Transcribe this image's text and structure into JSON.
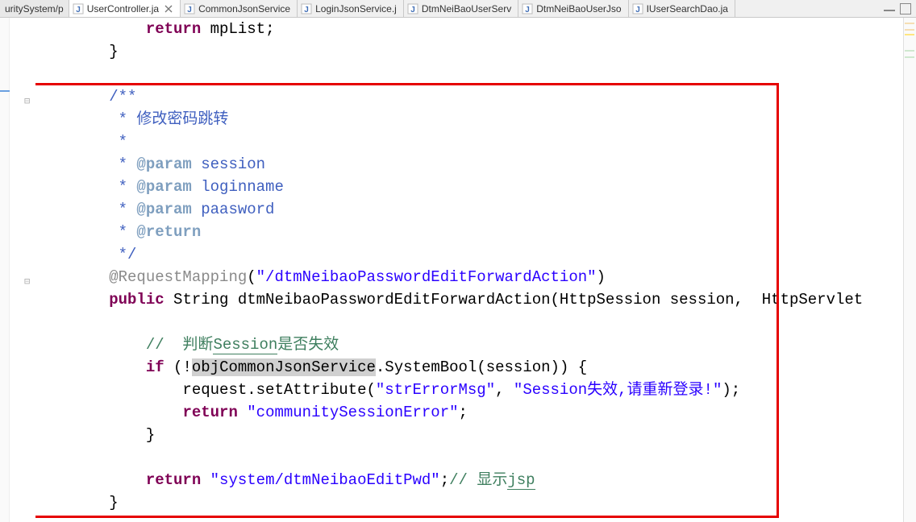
{
  "truncated_tab": "uritySystem/p",
  "tabs": [
    {
      "label": "UserController.ja",
      "active": true,
      "closable": true
    },
    {
      "label": "CommonJsonService",
      "active": false,
      "closable": false
    },
    {
      "label": "LoginJsonService.j",
      "active": false,
      "closable": false
    },
    {
      "label": "DtmNeiBaoUserServ",
      "active": false,
      "closable": false
    },
    {
      "label": "DtmNeiBaoUserJso",
      "active": false,
      "closable": false
    },
    {
      "label": "IUserSearchDao.ja",
      "active": false,
      "closable": false
    }
  ],
  "code": {
    "l1_return": "return",
    "l1_rest": " mpList;",
    "l2": "        }",
    "jdoc_open": "/**",
    "jdoc_desc": " * 修改密码跳转",
    "jdoc_blank": " *",
    "jdoc_tag_param": "@param",
    "jdoc_p1": " session",
    "jdoc_p2": " loginname",
    "jdoc_p3": " paasword",
    "jdoc_tag_return": "@return",
    "jdoc_close": " */",
    "anno_name": "@RequestMapping",
    "anno_arg": "\"/dtmNeibaoPasswordEditForwardAction\"",
    "sig_public": "public",
    "sig_rest": " String dtmNeibaoPasswordEditForwardAction(HttpSession session,  HttpServlet",
    "cmt1_a": "//  判断",
    "cmt1_b": "Session",
    "cmt1_c": "是否失效",
    "if_kw": "if",
    "if_open": " (!",
    "if_obj": "objCommonJsonService",
    "if_rest": ".SystemBool(session)) {",
    "req_a": "                request.setAttribute(",
    "req_s1": "\"strErrorMsg\"",
    "req_mid": ", ",
    "req_s2a": "\"Session",
    "req_s2b": "失效,请重新登录",
    "req_s2c": "!\"",
    "req_end": ");",
    "ret2_kw": "return",
    "ret2_s": "\"communitySessionError\"",
    "ret2_end": ";",
    "close_inner": "            }",
    "ret3_kw": "return",
    "ret3_s": "\"system/dtmNeibaoEditPwd\"",
    "ret3_end": ";",
    "cmt2_a": "// 显示",
    "cmt2_b": "jsp",
    "close_outer": "        }"
  },
  "colors": {
    "keyword": "#7f0055",
    "javadoc": "#3f5fbf",
    "javadoc_tag": "#7f9fbf",
    "comment": "#3f7f5f",
    "string": "#2a00ff",
    "annotation": "#8a8a8a",
    "highlight": "#d0d0d0",
    "redbox": "#e60000"
  }
}
